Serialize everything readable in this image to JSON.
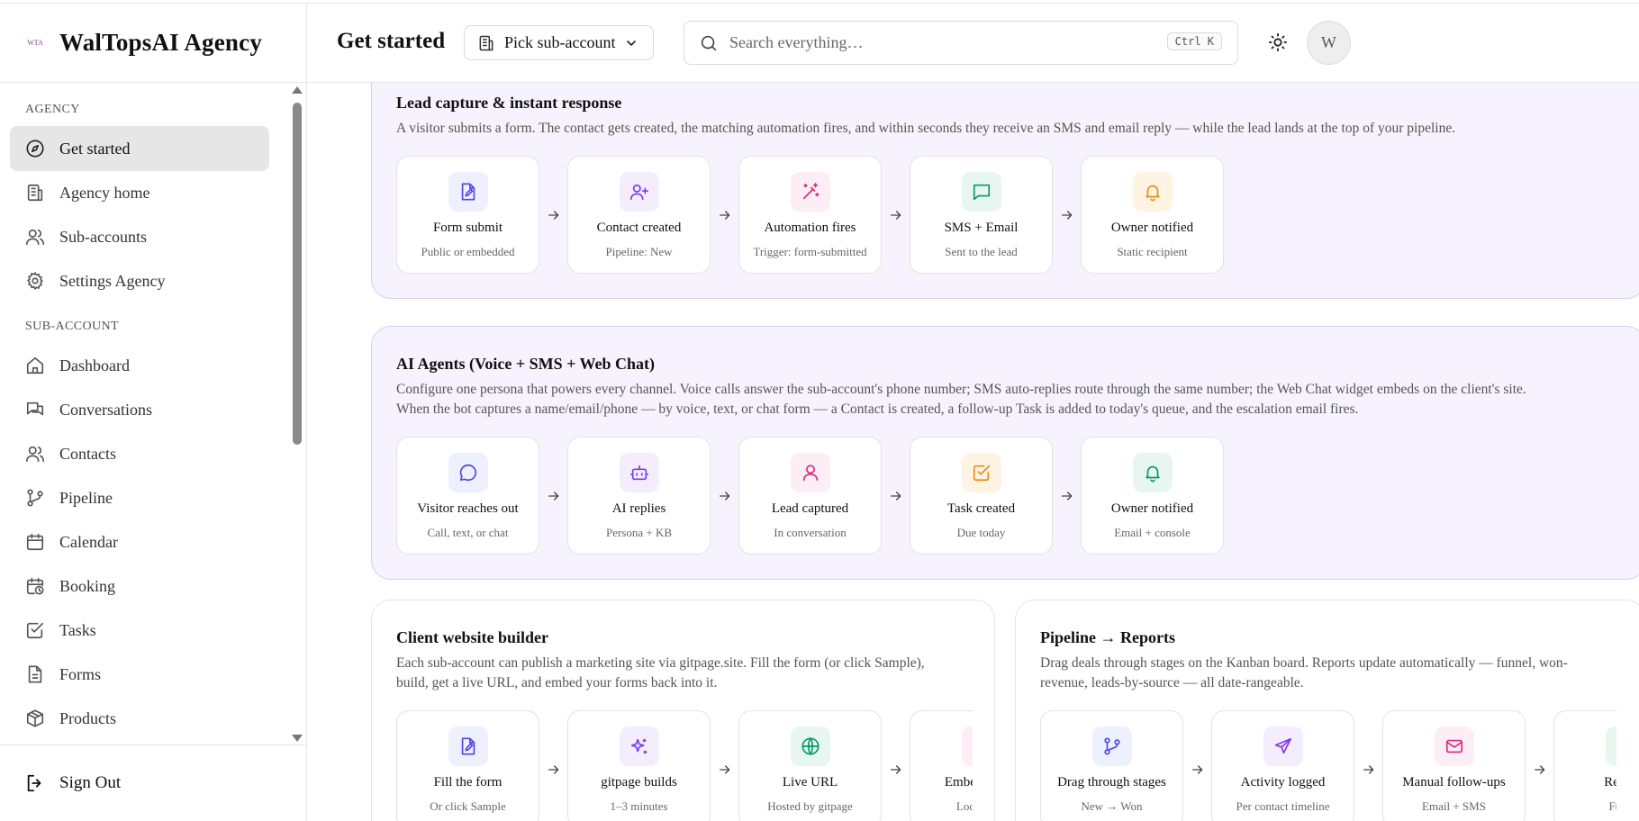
{
  "brand": {
    "logo_text": "WTA",
    "name": "WalTopsAI Agency"
  },
  "header": {
    "title": "Get started",
    "subaccount_button": "Pick sub-account",
    "search_placeholder": "Search everything…",
    "search_shortcut": "Ctrl K",
    "avatar_initial": "W"
  },
  "sidebar": {
    "agency_label": "AGENCY",
    "agency_items": [
      {
        "label": "Get started",
        "icon": "compass-icon",
        "active": true
      },
      {
        "label": "Agency home",
        "icon": "building-icon"
      },
      {
        "label": "Sub-accounts",
        "icon": "users-icon"
      },
      {
        "label": "Settings Agency",
        "icon": "gear-icon"
      }
    ],
    "subaccount_label": "SUB-ACCOUNT",
    "subaccount_items": [
      {
        "label": "Dashboard",
        "icon": "home-icon"
      },
      {
        "label": "Conversations",
        "icon": "chat-icon"
      },
      {
        "label": "Contacts",
        "icon": "users-icon"
      },
      {
        "label": "Pipeline",
        "icon": "git-branch-icon"
      },
      {
        "label": "Calendar",
        "icon": "calendar-icon"
      },
      {
        "label": "Booking",
        "icon": "calendar-clock-icon"
      },
      {
        "label": "Tasks",
        "icon": "checkbox-icon"
      },
      {
        "label": "Forms",
        "icon": "document-icon"
      },
      {
        "label": "Products",
        "icon": "package-icon"
      }
    ],
    "sign_out": "Sign Out"
  },
  "panels": {
    "lead": {
      "title": "Lead capture & instant response",
      "description": "A visitor submits a form. The contact gets created, the matching automation fires, and within seconds they receive an SMS and email reply — while the lead lands at the top of your pipeline.",
      "steps": [
        {
          "title": "Form submit",
          "sub": "Public or embedded",
          "icon": "form-edit-icon",
          "color": "#4f46e5",
          "bg": "#eef0fd"
        },
        {
          "title": "Contact created",
          "sub": "Pipeline: New",
          "icon": "user-plus-icon",
          "color": "#7c3aed",
          "bg": "#f3edfd"
        },
        {
          "title": "Automation fires",
          "sub": "Trigger: form-submitted",
          "icon": "magic-wand-icon",
          "color": "#db2777",
          "bg": "#fdedf5"
        },
        {
          "title": "SMS + Email",
          "sub": "Sent to the lead",
          "icon": "message-square-icon",
          "color": "#059669",
          "bg": "#e7f7f0"
        },
        {
          "title": "Owner notified",
          "sub": "Static recipient",
          "icon": "bell-icon",
          "color": "#ea8c0c",
          "bg": "#fff3e3"
        }
      ]
    },
    "ai": {
      "title": "AI Agents (Voice + SMS + Web Chat)",
      "description_line1": "Configure one persona that powers every channel. Voice calls answer the sub-account's phone number; SMS auto-replies route through the same number; the Web Chat widget embeds on the client's site.",
      "description_line2": "When the bot captures a name/email/phone — by voice, text, or chat form — a Contact is created, a follow-up Task is added to today's queue, and the escalation email fires.",
      "steps": [
        {
          "title": "Visitor reaches out",
          "sub": "Call, text, or chat",
          "icon": "chat-bubble-icon",
          "color": "#4f46e5",
          "bg": "#eef0fd"
        },
        {
          "title": "AI replies",
          "sub": "Persona + KB",
          "icon": "bot-icon",
          "color": "#7c3aed",
          "bg": "#f3edfd"
        },
        {
          "title": "Lead captured",
          "sub": "In conversation",
          "icon": "user-icon",
          "color": "#db2777",
          "bg": "#fdedf5"
        },
        {
          "title": "Task created",
          "sub": "Due today",
          "icon": "check-square-icon",
          "color": "#ea8c0c",
          "bg": "#fff3e3"
        },
        {
          "title": "Owner notified",
          "sub": "Email + console",
          "icon": "bell-icon",
          "color": "#059669",
          "bg": "#e7f7f0"
        }
      ]
    },
    "website": {
      "title": "Client website builder",
      "description_line1": "Each sub-account can publish a marketing site via gitpage.site. Fill the form (or click Sample),",
      "description_line2": "build, get a live URL, and embed your forms back into it.",
      "steps": [
        {
          "title": "Fill the form",
          "sub": "Or click Sample",
          "icon": "form-edit-icon",
          "color": "#4f46e5",
          "bg": "#eef0fd"
        },
        {
          "title": "gitpage builds",
          "sub": "1–3 minutes",
          "icon": "sparkles-icon",
          "color": "#7c3aed",
          "bg": "#f3edfd"
        },
        {
          "title": "Live URL",
          "sub": "Hosted by gitpage",
          "icon": "globe-icon",
          "color": "#059669",
          "bg": "#e7f7f0"
        },
        {
          "title": "Embed forms",
          "sub": "Loop back",
          "icon": "code-icon",
          "color": "#db2777",
          "bg": "#fdedf5"
        }
      ]
    },
    "pipeline": {
      "title": "Pipeline → Reports",
      "description_line1": "Drag deals through stages on the Kanban board. Reports update automatically — funnel, won-",
      "description_line2": "revenue, leads-by-source — all date-rangeable.",
      "steps": [
        {
          "title": "Drag through stages",
          "sub": "New → Won",
          "icon": "git-branch-icon",
          "color": "#4f46e5",
          "bg": "#eef0fd"
        },
        {
          "title": "Activity logged",
          "sub": "Per contact timeline",
          "icon": "send-icon",
          "color": "#7c3aed",
          "bg": "#f3edfd"
        },
        {
          "title": "Manual follow-ups",
          "sub": "Email + SMS",
          "icon": "mail-icon",
          "color": "#db2777",
          "bg": "#fdedf5"
        },
        {
          "title": "Reports",
          "sub": "Funnel",
          "icon": "chart-icon",
          "color": "#059669",
          "bg": "#e7f7f0"
        }
      ]
    }
  }
}
